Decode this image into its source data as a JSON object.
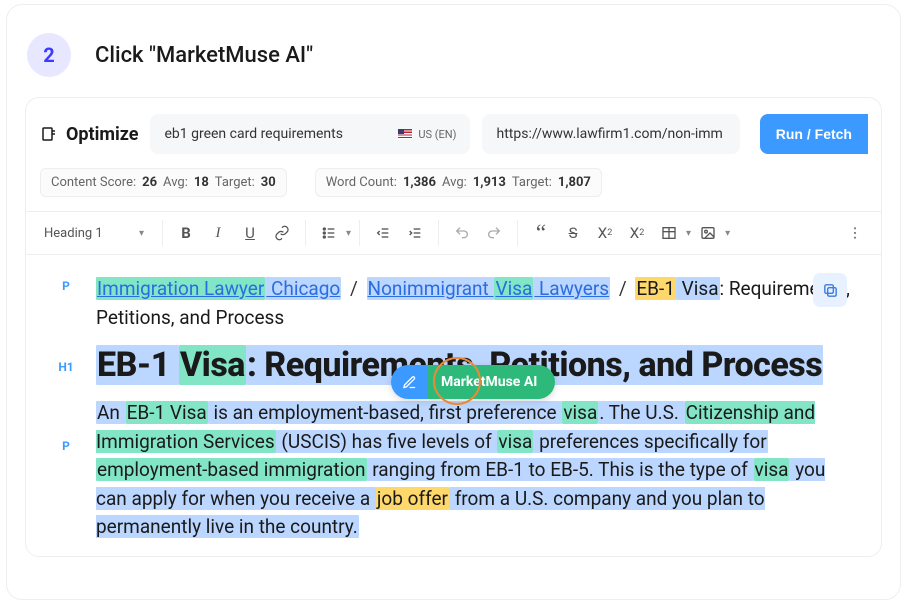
{
  "step": {
    "num": "2",
    "title": "Click \"MarketMuse AI\""
  },
  "optimize": {
    "label": "Optimize",
    "search_value": "eb1 green card requirements",
    "locale": "US (EN)",
    "url_value": "https://www.lawfirm1.com/non-imm",
    "run_label": "Run / Fetch"
  },
  "metrics": {
    "content_score_label": "Content Score:",
    "content_score": "26",
    "cs_avg_label": "Avg:",
    "cs_avg": "18",
    "cs_target_label": "Target:",
    "cs_target": "30",
    "word_count_label": "Word Count:",
    "word_count": "1,386",
    "wc_avg_label": "Avg:",
    "wc_avg": "1,913",
    "wc_target_label": "Target:",
    "wc_target": "1,807"
  },
  "toolbar": {
    "heading_select": "Heading 1"
  },
  "floating": {
    "ai_label": "MarketMuse AI"
  },
  "content": {
    "breadcrumb": {
      "link1_a": "Immigration Lawyer",
      "link1_b": " Chicago",
      "link2_a": "Nonimmigrant ",
      "link2_b": "Visa",
      "link2_c": " Lawyers",
      "title_a": "EB-1",
      "title_b": " Visa",
      "title_rest": ": Requirements, Petitions, and Process",
      "sep": "/"
    },
    "h1": {
      "a": "EB-1 ",
      "b": "Visa",
      "c": ": Requirements, Petitions, and Process"
    },
    "para": {
      "t1": "An ",
      "hl1": "EB-1 Visa",
      "t2": " is an employment-based, first preference ",
      "hl2": "visa",
      "t3": ". The U.S. ",
      "hl3": "Citizenship and Immigration Services",
      "t4": " (USCIS) has five levels of ",
      "hl4": "visa",
      "t5": " preferences specifically for ",
      "hl5": "employment-based immigration",
      "t6": " ranging from EB-1 to EB-5. This is the type of ",
      "hl6": "visa",
      "t7": " you can apply for when you receive a ",
      "hl7": "job offer",
      "t8": " from a U.S. company and you plan to permanently live in the country."
    },
    "tags": {
      "p": "P",
      "h1": "H1"
    }
  }
}
